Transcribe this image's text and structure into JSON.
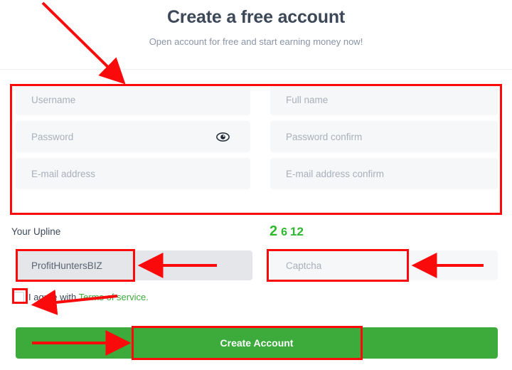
{
  "header": {
    "title": "Create a free account",
    "subtitle": "Open account for free and start earning money now!"
  },
  "form": {
    "fields": [
      {
        "name": "username",
        "placeholder": "Username",
        "value": "",
        "column": "left"
      },
      {
        "name": "full-name",
        "placeholder": "Full name",
        "value": "",
        "column": "right"
      },
      {
        "name": "password",
        "placeholder": "Password",
        "value": "",
        "column": "left"
      },
      {
        "name": "password-confirm",
        "placeholder": "Password confirm",
        "value": "",
        "column": "right"
      },
      {
        "name": "email",
        "placeholder": "E-mail address",
        "value": "",
        "column": "left"
      },
      {
        "name": "email-confirm",
        "placeholder": "E-mail address confirm",
        "value": "",
        "column": "right"
      }
    ],
    "password_toggle_icon": "eye-icon"
  },
  "upline": {
    "label": "Your Upline",
    "value": "ProfitHuntersBIZ"
  },
  "captcha": {
    "digits": [
      "2",
      "6",
      "12"
    ],
    "placeholder": "Captcha",
    "value": "",
    "color": "#2eb82e"
  },
  "terms": {
    "checked": false,
    "prefix": "I agree with ",
    "link_label": "Terms of service.",
    "link_color": "#3cab3c"
  },
  "submit": {
    "label": "Create Account",
    "color": "#3cab3c"
  },
  "annotation": {
    "color": "#fa0a0a"
  }
}
